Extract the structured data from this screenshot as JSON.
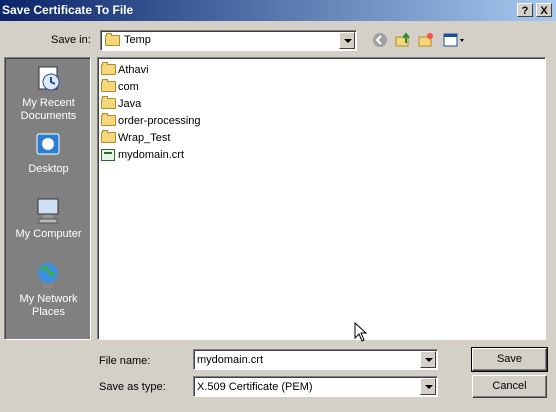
{
  "window": {
    "title": "Save Certificate To File"
  },
  "titlebar_buttons": {
    "help": "?",
    "close": "X"
  },
  "save_in": {
    "label": "Save in:",
    "value": "Temp"
  },
  "places": [
    {
      "label": "My Recent Documents",
      "icon": "recent-documents-icon"
    },
    {
      "label": "Desktop",
      "icon": "desktop-icon"
    },
    {
      "label": "My Computer",
      "icon": "my-computer-icon"
    },
    {
      "label": "My Network Places",
      "icon": "network-places-icon"
    }
  ],
  "files": [
    {
      "name": "Athavi",
      "type": "folder"
    },
    {
      "name": "com",
      "type": "folder"
    },
    {
      "name": "Java",
      "type": "folder"
    },
    {
      "name": "order-processing",
      "type": "folder"
    },
    {
      "name": "Wrap_Test",
      "type": "folder"
    },
    {
      "name": "mydomain.crt",
      "type": "certificate"
    }
  ],
  "filename": {
    "label": "File name:",
    "value": "mydomain.crt"
  },
  "filetype": {
    "label": "Save as type:",
    "value": "X.509 Certificate (PEM)"
  },
  "buttons": {
    "save": "Save",
    "cancel": "Cancel"
  }
}
